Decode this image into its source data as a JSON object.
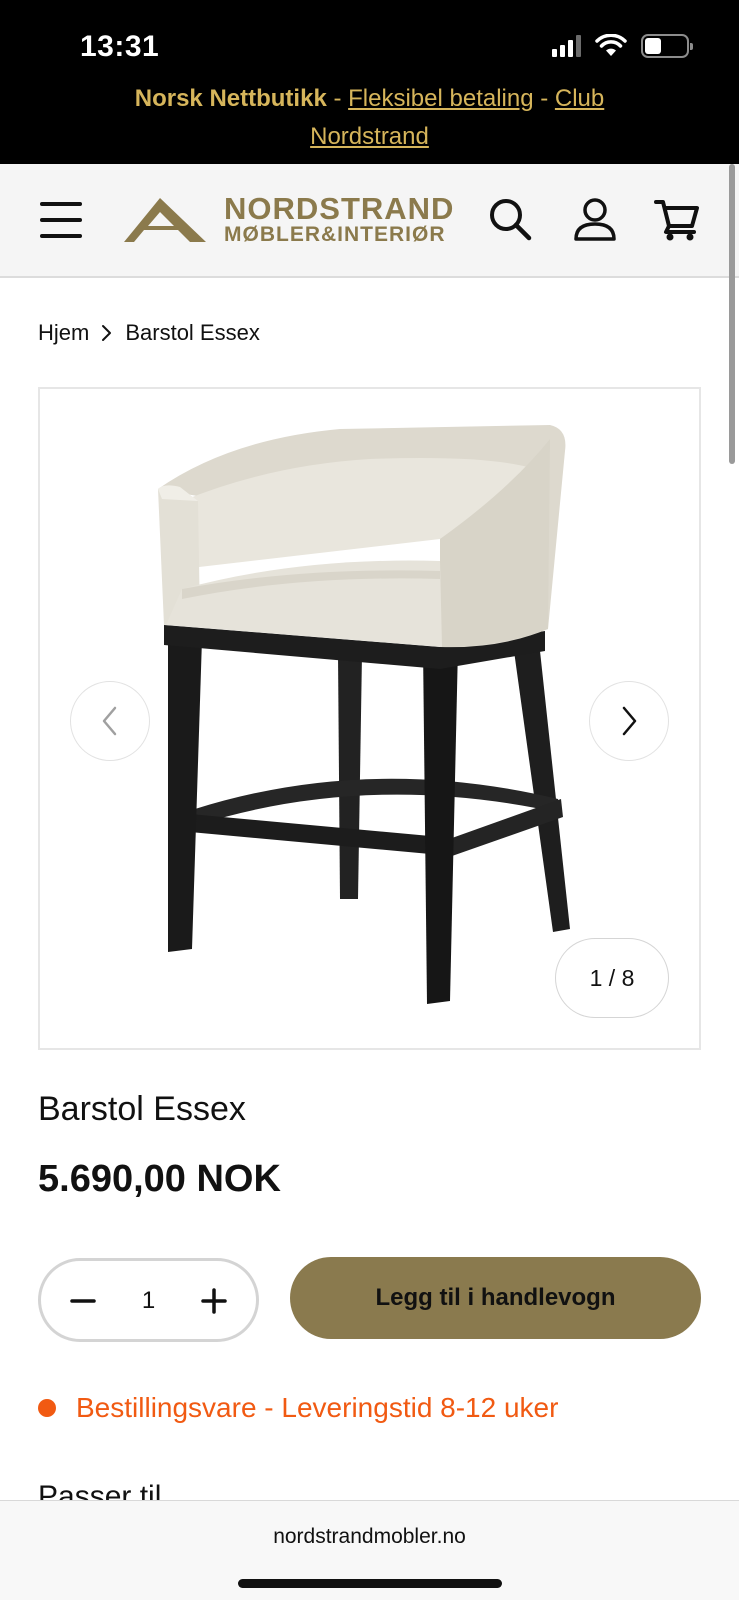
{
  "status_bar": {
    "time": "13:31",
    "icons": [
      "cellular-signal-icon",
      "wifi-icon",
      "battery-icon"
    ],
    "battery_level": 0.4
  },
  "announcement": {
    "bold_text": "Norsk Nettbutikk",
    "separator": " - ",
    "link1": "Fleksibel betaling",
    "link2": "Club Nordstrand",
    "color": "#d6b55b"
  },
  "header": {
    "logo_line1": "NORDSTRAND",
    "logo_line2": "MØBLER&INTERIØR",
    "brand_color": "#8b7a4c",
    "icons": [
      "menu-icon",
      "search-icon",
      "account-icon",
      "cart-icon"
    ]
  },
  "breadcrumb": {
    "home": "Hjem",
    "current": "Barstol Essex"
  },
  "gallery": {
    "counter": "1 / 8",
    "current_index": 1,
    "total": 8
  },
  "product": {
    "title": "Barstol Essex",
    "price": "5.690,00 NOK",
    "quantity": "1",
    "add_to_cart_label": "Legg til i handlevogn",
    "button_color": "#8a7a4e",
    "stock_status": "Bestillingsvare - Leveringstid 8-12 uker",
    "stock_color": "#f15a12",
    "next_section": "Passer til"
  },
  "browser": {
    "url": "nordstrandmobler.no"
  }
}
